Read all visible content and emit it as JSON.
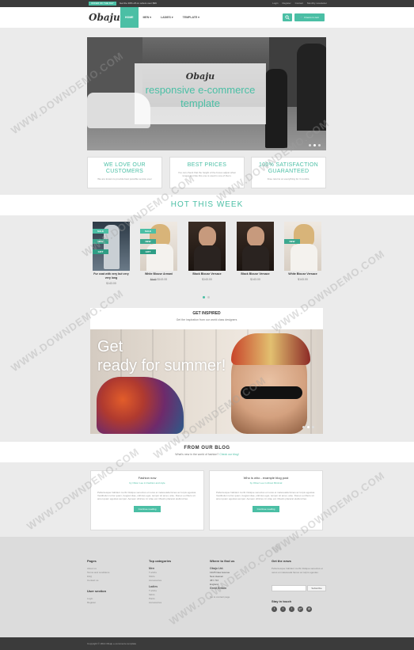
{
  "colors": {
    "accent": "#4bbfa5",
    "dark_bar": "#3b3b3b",
    "page_bg": "#ebebeb"
  },
  "topbar": {
    "promo_badge": "OFFER OF THE DAY",
    "promo_text": "Get the 30% off on orders over $99",
    "links": [
      "Login",
      "Register",
      "Contact",
      "Monthly newsletter"
    ]
  },
  "header": {
    "logo": "Obaju",
    "nav": [
      {
        "label": "HOME",
        "active": true
      },
      {
        "label": "MEN ▾",
        "active": false
      },
      {
        "label": "LADIES ▾",
        "active": false
      },
      {
        "label": "TEMPLATE ▾",
        "active": false
      }
    ],
    "search_icon": "search-icon",
    "cart_label": "3 items in cart"
  },
  "hero": {
    "logo": "Obaju",
    "tagline": "responsive e-commerce template"
  },
  "features": [
    {
      "title": "WE LOVE OUR CUSTOMERS",
      "text": "We are known to provide best possible service ever"
    },
    {
      "title": "BEST PRICES",
      "text": "You can check that the height of the boxes adjust when longer text like this one is used in one of them."
    },
    {
      "title": "100% SATISFACTION GUARANTEED",
      "text": "Free returns on everything for 3 months."
    }
  ],
  "hot": {
    "title": "HOT THIS WEEK",
    "products": [
      {
        "name": "Fur coat with very but very very long",
        "price": "$143.00",
        "badges": [
          "SALE",
          "NEW",
          "GIFT"
        ]
      },
      {
        "name": "White Blouse Armani",
        "price": "$143.00",
        "old_price": "$143",
        "badges": [
          "SALE",
          "NEW",
          "GIFT"
        ]
      },
      {
        "name": "Black Blouse Versace",
        "price": "$143.00",
        "badges": []
      },
      {
        "name": "Black Blouse Versace",
        "price": "$143.00",
        "badges": []
      },
      {
        "name": "White Blouse Versace",
        "price": "$143.00",
        "badges": [
          "NEW"
        ]
      }
    ]
  },
  "inspired": {
    "title": "GET INSPIRED",
    "subtitle": "Get the inspiration from our world class designers",
    "banner_text_1": "Get",
    "banner_text_2": "ready for summer!"
  },
  "blog": {
    "title": "FROM OUR BLOG",
    "subtitle": "What's new in the world of fashion?",
    "subtitle_link": "Check our blog!",
    "posts": [
      {
        "title": "Fashion now",
        "meta": "by Oliver Lee in Fashion and style",
        "excerpt": "Pellentesque habitant morbi tristique senectus et netus et malesuada fames ac turpis egestas. Vestibulum tortor quam, feugiat vitae, ultricies eget, tempor sit amet, ante. Donec eu libero sit amet quam egestas semper. Aenean ultricies mi vitae est. Mauris placerat eleifend leo.",
        "button": "Continue reading"
      },
      {
        "title": "Who is who - example blog post",
        "meta": "by Oliver Lee in About Minimal",
        "excerpt": "Pellentesque habitant morbi tristique senectus et netus et malesuada fames ac turpis egestas. Vestibulum tortor quam, feugiat vitae, ultricies eget, tempor sit amet, ante. Donec eu libero sit amet quam egestas semper. Aenean ultricies mi vitae est. Mauris placerat eleifend leo.",
        "button": "Continue reading"
      }
    ]
  },
  "footer": {
    "pages": {
      "title": "Pages",
      "links": [
        "About us",
        "Terms and conditions",
        "FAQ",
        "Contact us"
      ]
    },
    "user": {
      "title": "User section",
      "links": [
        "Login",
        "Register"
      ]
    },
    "categories": {
      "title": "Top categories",
      "men_label": "Men",
      "men": [
        "T-shirts",
        "Shirts",
        "Accessories"
      ],
      "ladies_label": "Ladies",
      "ladies": [
        "T-shirts",
        "Skirts",
        "Pants",
        "Accessories"
      ]
    },
    "find": {
      "title": "Where to find us",
      "company": "Obaju Ltd.",
      "address": [
        "13/25 New Avenue",
        "New Heaven",
        "45Y 73J",
        "England"
      ],
      "country": "Great Britain",
      "link": "Go to contact page"
    },
    "news": {
      "title": "Get the news",
      "text": "Pellentesque habitant morbi tristique senectus et netus et malesuada fames ac turpis egestas.",
      "button": "Subscribe",
      "stay": "Stay in touch",
      "social": [
        "f",
        "t",
        "i",
        "g+",
        "@"
      ]
    }
  },
  "copyright": "Copyright © 2014 Obaju e-commerce template",
  "watermark": "WWW.DOWNDEMO.COM"
}
